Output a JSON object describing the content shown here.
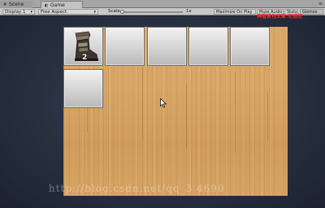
{
  "tabs": {
    "scene": {
      "label": "Scene",
      "icon": "scene-icon"
    },
    "game": {
      "label": "Game",
      "icon": "game-icon"
    },
    "right": "≡"
  },
  "toolbar": {
    "display": "Display 1",
    "aspect": "Free Aspect",
    "scale_label": "Scale",
    "scale_value": "1x",
    "maximize": "Maximize On Play",
    "mute": "Mute Audio",
    "stats": "Stats",
    "gizmos": "Gizmos"
  },
  "overlay": "再看背包文章 欢迎您",
  "inventory": {
    "slots": [
      {
        "item": "boot",
        "count": "2"
      },
      {
        "item": "",
        "count": ""
      },
      {
        "item": "",
        "count": ""
      },
      {
        "item": "",
        "count": ""
      },
      {
        "item": "",
        "count": ""
      },
      {
        "item": "",
        "count": ""
      }
    ]
  },
  "watermark": "http://blog.csdn.net/qq_3 4690",
  "colors": {
    "overlay": "#ff2a2a",
    "board": "#d9a86a",
    "viewport": "#28303f"
  }
}
